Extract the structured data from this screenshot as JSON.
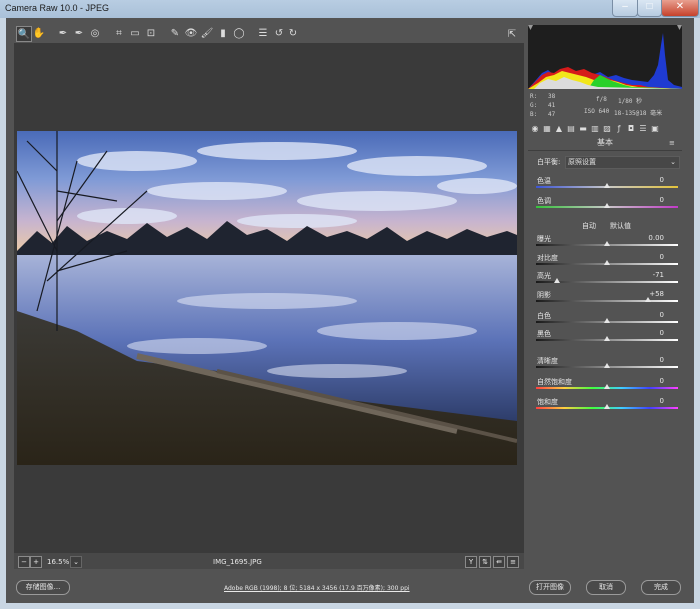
{
  "window": {
    "title": "Camera Raw 10.0 - JPEG",
    "min": "–",
    "max": "□",
    "close": "✕"
  },
  "toolbar": {
    "tools": [
      {
        "name": "zoom-tool",
        "glyph": "🔍"
      },
      {
        "name": "hand-tool",
        "glyph": "✋"
      },
      {
        "name": "white-balance-tool",
        "glyph": "✒"
      },
      {
        "name": "color-sampler-tool",
        "glyph": "✒"
      },
      {
        "name": "target-adjustment-tool",
        "glyph": "◎"
      },
      {
        "name": "crop-tool",
        "glyph": "⌗"
      },
      {
        "name": "straighten-tool",
        "glyph": "▭"
      },
      {
        "name": "transform-tool",
        "glyph": "⊡"
      },
      {
        "name": "spot-removal-tool",
        "glyph": "✎"
      },
      {
        "name": "red-eye-tool",
        "glyph": "👁"
      },
      {
        "name": "adjustment-brush-tool",
        "glyph": "🖌"
      },
      {
        "name": "graduated-filter-tool",
        "glyph": "▮"
      },
      {
        "name": "radial-filter-tool",
        "glyph": "◯"
      },
      {
        "name": "preferences-tool",
        "glyph": "☰"
      },
      {
        "name": "rotate-left-tool",
        "glyph": "↺"
      },
      {
        "name": "rotate-right-tool",
        "glyph": "↻"
      }
    ],
    "fullscreen": "⇱"
  },
  "status": {
    "zoom": "16.5%",
    "filename": "IMG_1695.JPG",
    "zoom_minus": "−",
    "zoom_plus": "+",
    "dropdown": "⌄",
    "y": "Y",
    "b1": "⇅",
    "b2": "⇚",
    "b3": "≡"
  },
  "info": {
    "r_label": "R:",
    "r": "38",
    "g_label": "G:",
    "g": "41",
    "b_label": "B:",
    "b": "47",
    "aperture": "f/8",
    "shutter": "1/80 秒",
    "iso": "ISO 640",
    "lens": "18-135@18 毫米"
  },
  "panel": {
    "title": "基本",
    "wb_label": "白平衡:",
    "wb_value": "原照设置",
    "auto": "自动",
    "default": "默认值",
    "sliders": [
      {
        "label": "色温",
        "value": "0",
        "pos": 0.5,
        "grad": "temp"
      },
      {
        "label": "色调",
        "value": "0",
        "pos": 0.5,
        "grad": "tint"
      },
      {
        "label": "曝光",
        "value": "0.00",
        "pos": 0.5,
        "grad": "none"
      },
      {
        "label": "对比度",
        "value": "0",
        "pos": 0.5,
        "grad": "none"
      },
      {
        "label": "高光",
        "value": "-71",
        "pos": 0.145,
        "grad": "none"
      },
      {
        "label": "阴影",
        "value": "+58",
        "pos": 0.79,
        "grad": "none"
      },
      {
        "label": "白色",
        "value": "0",
        "pos": 0.5,
        "grad": "none"
      },
      {
        "label": "黑色",
        "value": "0",
        "pos": 0.5,
        "grad": "none"
      },
      {
        "label": "清晰度",
        "value": "0",
        "pos": 0.5,
        "grad": "none"
      },
      {
        "label": "自然饱和度",
        "value": "0",
        "pos": 0.5,
        "grad": "sat"
      },
      {
        "label": "饱和度",
        "value": "0",
        "pos": 0.5,
        "grad": "sat"
      }
    ]
  },
  "footer": {
    "save": "存储图像...",
    "workflow": "Adobe RGB (1998); 8 位; 5184 x 3456 (17.9 百万像素); 300 ppi",
    "open": "打开图像",
    "cancel": "取消",
    "done": "完成"
  },
  "colors": {
    "bg": "#535353",
    "panel": "#3a3a3a",
    "accent": "#ffffff"
  }
}
